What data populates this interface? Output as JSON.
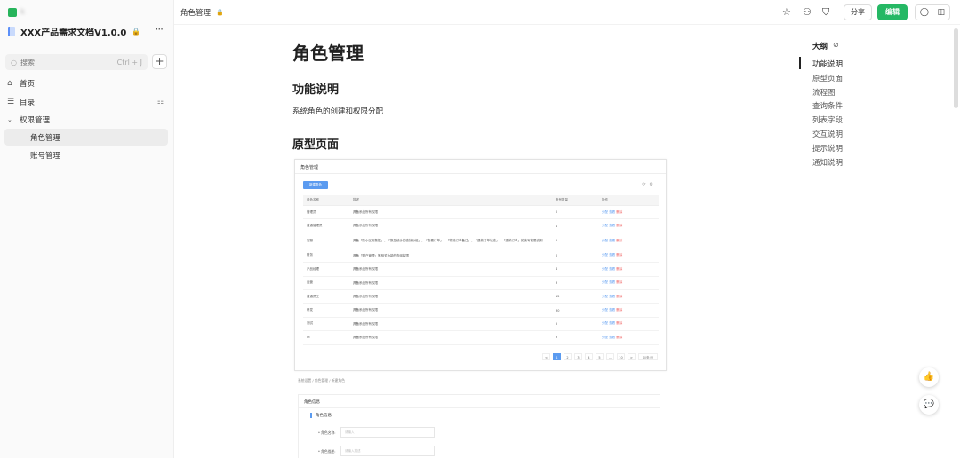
{
  "sidebar": {
    "user_name": "k",
    "doc_title": "XXX产品需求文档V1.0.0",
    "search_placeholder": "搜索",
    "search_shortcut": "Ctrl + J",
    "nav": [
      {
        "label": "首页"
      },
      {
        "label": "目录"
      },
      {
        "label": "权限管理"
      },
      {
        "label": "角色管理"
      },
      {
        "label": "账号管理"
      }
    ]
  },
  "header": {
    "breadcrumb": "角色管理",
    "share_label": "分享",
    "edit_label": "编辑"
  },
  "content": {
    "title": "角色管理",
    "section1": "功能说明",
    "desc": "系统角色的创建和权限分配",
    "section2": "原型页面"
  },
  "prototype": {
    "title": "角色管理",
    "add_button": "新建角色",
    "columns": [
      "角色名称",
      "描述",
      "账号数量",
      "操作"
    ],
    "rows": [
      {
        "name": "管理员",
        "desc": "具备系统所有权限",
        "count": "0"
      },
      {
        "name": "普通管理员",
        "desc": "具备系统所有权限",
        "count": "1"
      },
      {
        "name": "客服",
        "desc": "具备「防小区用数据」、「数量统计的查找分组」、「查看订单」、「物流订单备注」、「退款订单状态」、「退款订单」的读写权限说明",
        "count": "2"
      },
      {
        "name": "财务",
        "desc": "具备「财户管理」等相关功能的查阅权限",
        "count": "0"
      },
      {
        "name": "产品经理",
        "desc": "具备系统所有权限",
        "count": "4"
      },
      {
        "name": "运营",
        "desc": "具备系统所有权限",
        "count": "3"
      },
      {
        "name": "普通员工",
        "desc": "具备系统所有权限",
        "count": "12"
      },
      {
        "name": "研发",
        "desc": "具备系统所有权限",
        "count": "30"
      },
      {
        "name": "测试",
        "desc": "具备系统所有权限",
        "count": "5"
      },
      {
        "name": "UI",
        "desc": "具备系统所有权限",
        "count": "3"
      }
    ],
    "actions": {
      "edit": "分配",
      "view": "查看",
      "delete": "删除"
    },
    "pages": [
      "<",
      "1",
      "2",
      "3",
      "4",
      "5",
      "...",
      "10",
      ">"
    ],
    "page_size": "10条/页"
  },
  "prototype2": {
    "breadcrumb": "系统设置 / 角色管理 / 新建角色",
    "title": "角色信息",
    "section": "角色信息",
    "field1_label": "* 角色名称:",
    "field1_placeholder": "请输入",
    "field2_label": "* 角色描述:",
    "field2_placeholder": "请输入描述"
  },
  "outline": {
    "title": "大纲",
    "items": [
      "功能说明",
      "原型页面",
      "流程图",
      "查询条件",
      "列表字段",
      "交互说明",
      "提示说明",
      "通知说明"
    ]
  },
  "colors": {
    "accent_green": "#25b864",
    "link_blue": "#5b9bf0"
  }
}
